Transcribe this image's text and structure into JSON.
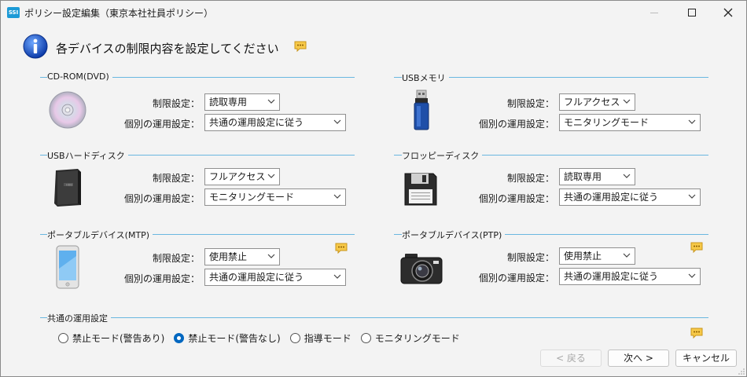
{
  "window": {
    "app_icon_text": "SSI",
    "title": "ポリシー設定編集（東京本社社員ポリシー）"
  },
  "header": {
    "text": "各デバイスの制限内容を設定してください"
  },
  "labels": {
    "restriction": "制限設定：",
    "individual": "個別の運用設定："
  },
  "devices": [
    {
      "name": "CD-ROM(DVD)",
      "restriction": "読取専用",
      "individual": "共通の運用設定に従う",
      "icon": "cd-icon"
    },
    {
      "name": "USBメモリ",
      "restriction": "フルアクセス",
      "individual": "モニタリングモード",
      "icon": "usb-memory-icon"
    },
    {
      "name": "USBハードディスク",
      "restriction": "フルアクセス",
      "individual": "モニタリングモード",
      "icon": "hard-disk-icon"
    },
    {
      "name": "フロッピーディスク",
      "restriction": "読取専用",
      "individual": "共通の運用設定に従う",
      "icon": "floppy-icon"
    },
    {
      "name": "ポータブルデバイス(MTP)",
      "restriction": "使用禁止",
      "individual": "共通の運用設定に従う",
      "icon": "smartphone-icon"
    },
    {
      "name": "ポータブルデバイス(PTP)",
      "restriction": "使用禁止",
      "individual": "共通の運用設定に従う",
      "icon": "camera-icon"
    }
  ],
  "common": {
    "title": "共通の運用設定",
    "options": [
      "禁止モード(警告あり)",
      "禁止モード(警告なし)",
      "指導モード",
      "モニタリングモード"
    ],
    "selected_index": 1
  },
  "buttons": {
    "back": "< 戻る",
    "next": "次へ >",
    "cancel": "キャンセル"
  }
}
